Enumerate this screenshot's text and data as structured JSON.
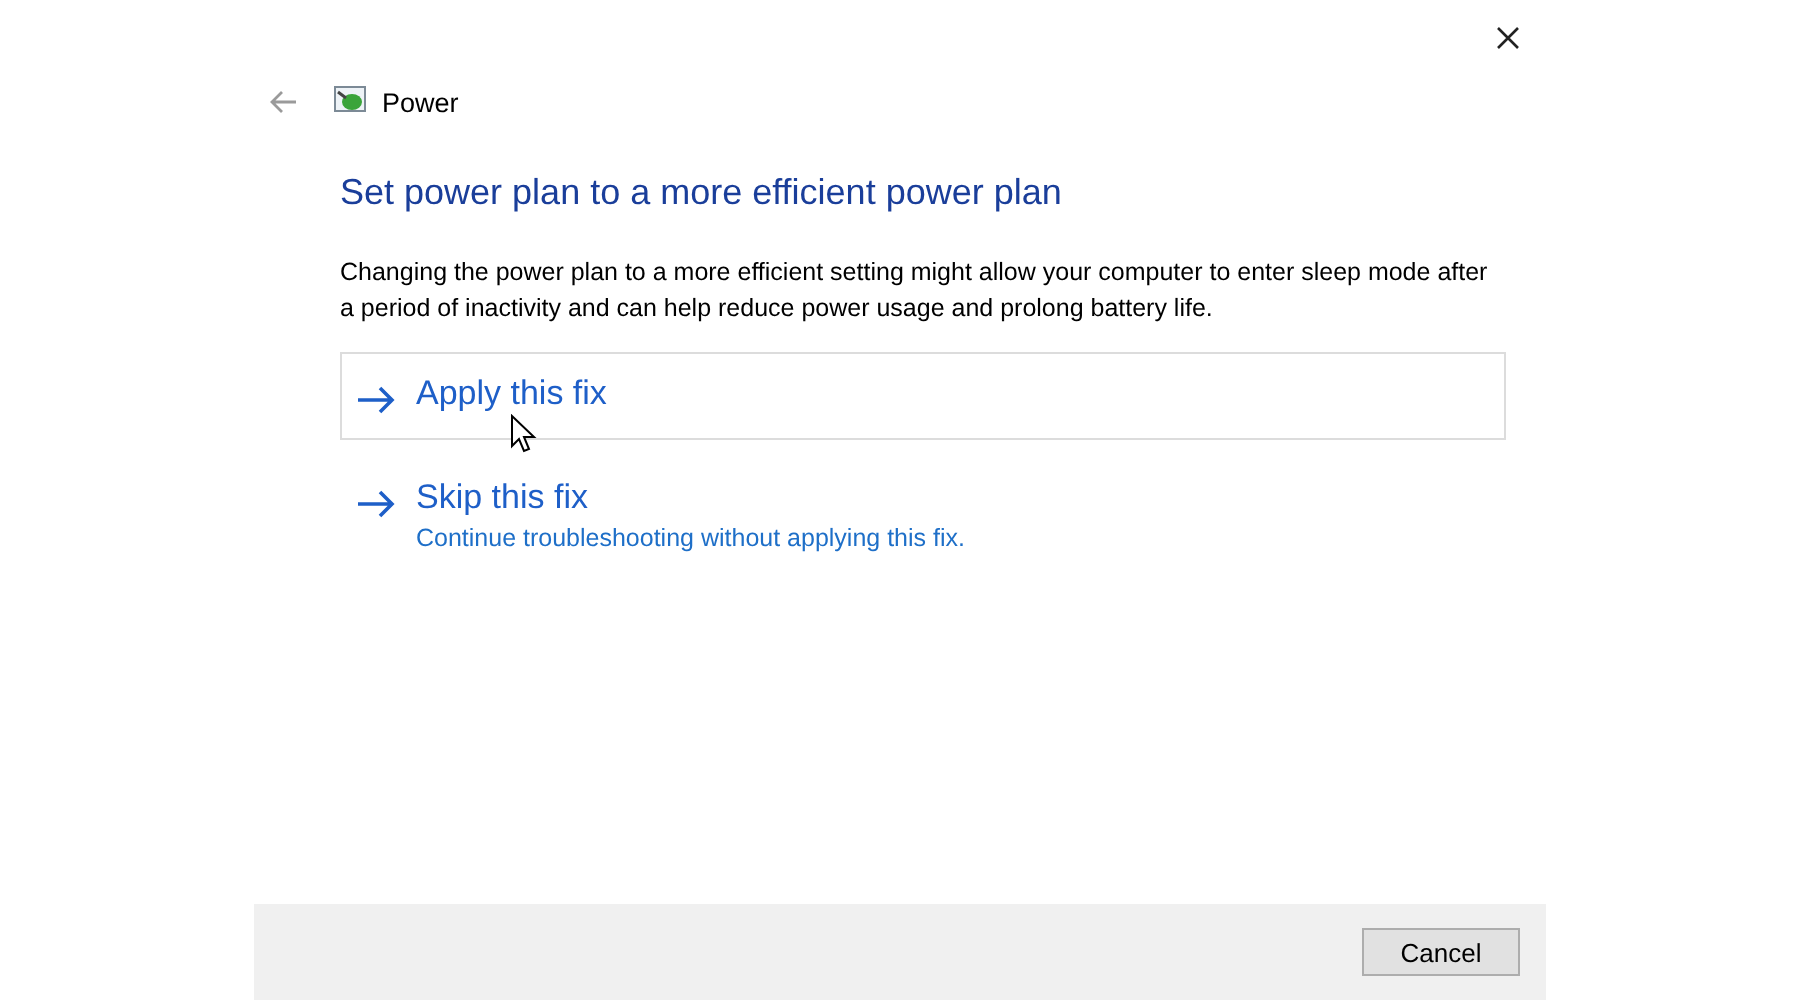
{
  "window": {
    "title": "Power"
  },
  "heading": "Set power plan to a more efficient power plan",
  "description": "Changing the power plan to a more efficient setting might allow your computer to enter sleep mode after a period of inactivity and can help reduce power usage and prolong battery life.",
  "options": [
    {
      "label": "Apply this fix",
      "hovered": true
    },
    {
      "label": "Skip this fix",
      "subtitle": "Continue troubleshooting without applying this fix.",
      "hovered": false
    }
  ],
  "footer": {
    "buttons": [
      "Cancel"
    ]
  }
}
